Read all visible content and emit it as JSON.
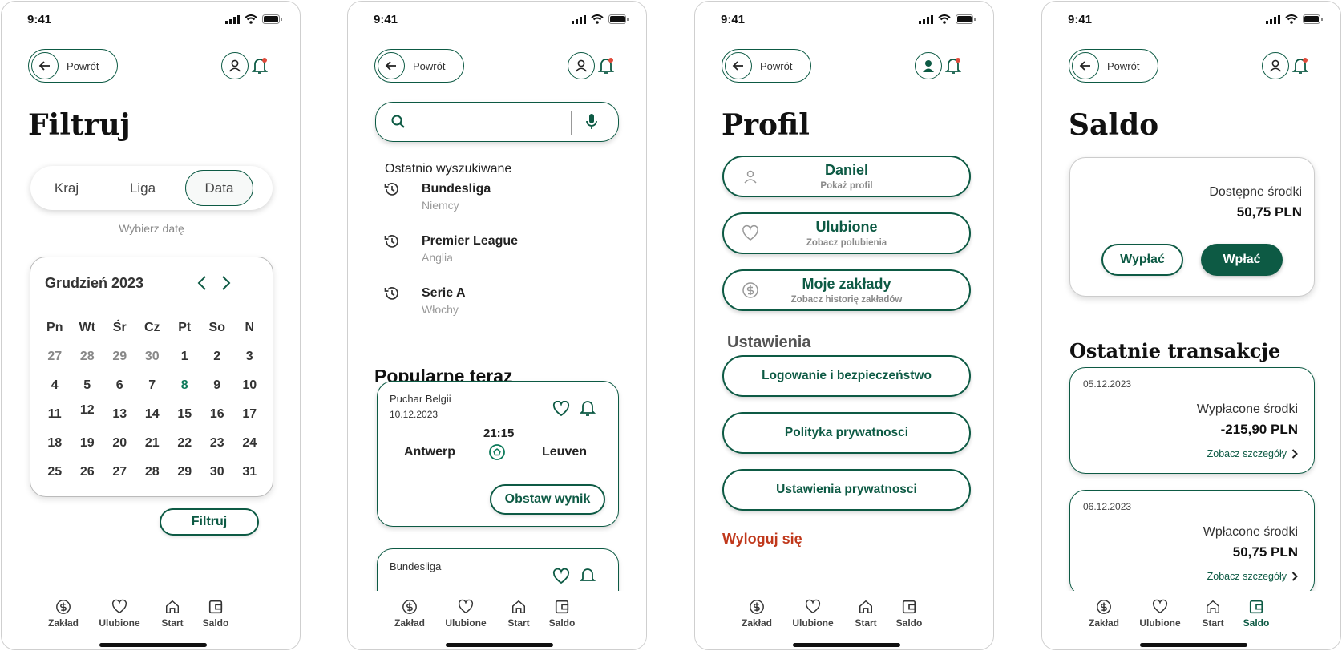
{
  "status": {
    "time": "9:41"
  },
  "common": {
    "back_label": "Powrót"
  },
  "nav": {
    "items": [
      {
        "label": "Zakład",
        "icon": "dollar-icon"
      },
      {
        "label": "Ulubione",
        "icon": "heart-icon"
      },
      {
        "label": "Start",
        "icon": "home-icon"
      },
      {
        "label": "Saldo",
        "icon": "wallet-icon"
      }
    ]
  },
  "filter": {
    "title": "Filtruj",
    "segments": [
      "Kraj",
      "Liga",
      "Data"
    ],
    "active_segment": "Data",
    "hint": "Wybierz datę",
    "calendar": {
      "month": "Grudzień 2023",
      "weekdays": [
        "Pn",
        "Wt",
        "Śr",
        "Cz",
        "Pt",
        "So",
        "N"
      ],
      "weeks": [
        [
          "27",
          "28",
          "29",
          "30",
          "1",
          "2",
          "3"
        ],
        [
          "4",
          "5",
          "6",
          "7",
          "8",
          "9",
          "10"
        ],
        [
          "11",
          "12",
          "13",
          "14",
          "15",
          "16",
          "17"
        ],
        [
          "18",
          "19",
          "20",
          "21",
          "22",
          "23",
          "24"
        ],
        [
          "25",
          "26",
          "27",
          "28",
          "29",
          "30",
          "31"
        ]
      ],
      "highlight": "8"
    },
    "apply_label": "Filtruj"
  },
  "search": {
    "placeholder": "",
    "recent_title": "Ostatnio wyszukiwane",
    "recent": [
      {
        "name": "Bundesliga",
        "country": "Niemcy"
      },
      {
        "name": "Premier League",
        "country": "Anglia"
      },
      {
        "name": "Serie A",
        "country": "Włochy"
      }
    ],
    "popular_title": "Popularne teraz",
    "matches": [
      {
        "league": "Puchar Belgii",
        "date": "10.12.2023",
        "time": "21:15",
        "home": "Antwerp",
        "away": "Leuven",
        "bet_label": "Obstaw wynik"
      },
      {
        "league": "Bundesliga"
      }
    ]
  },
  "profile": {
    "title": "Profil",
    "cards": [
      {
        "title": "Daniel",
        "sub": "Pokaż profil",
        "icon": "user-icon"
      },
      {
        "title": "Ulubione",
        "sub": "Zobacz polubienia",
        "icon": "heart-icon"
      },
      {
        "title": "Moje zakłady",
        "sub": "Zobacz historię zakładów",
        "icon": "dollar-icon"
      }
    ],
    "settings_title": "Ustawienia",
    "settings": [
      "Logowanie i bezpieczeństwo",
      "Polityka prywatnosci",
      "Ustawienia prywatnosci"
    ],
    "logout": "Wyloguj się"
  },
  "balance": {
    "title": "Saldo",
    "available_label": "Dostępne środki",
    "available_amount": "50,75 PLN",
    "withdraw_label": "Wypłać",
    "deposit_label": "Wpłać",
    "transactions_title": "Ostatnie transakcje",
    "transactions": [
      {
        "date": "05.12.2023",
        "label": "Wypłacone środki",
        "amount": "-215,90 PLN",
        "link": "Zobacz szczegóły"
      },
      {
        "date": "06.12.2023",
        "label": "Wpłacone środki",
        "amount": "50,75 PLN",
        "link": "Zobacz szczegóły"
      }
    ]
  },
  "colors": {
    "accent": "#0d5a44",
    "danger": "#c0381b",
    "notification": "#e04a3a"
  }
}
